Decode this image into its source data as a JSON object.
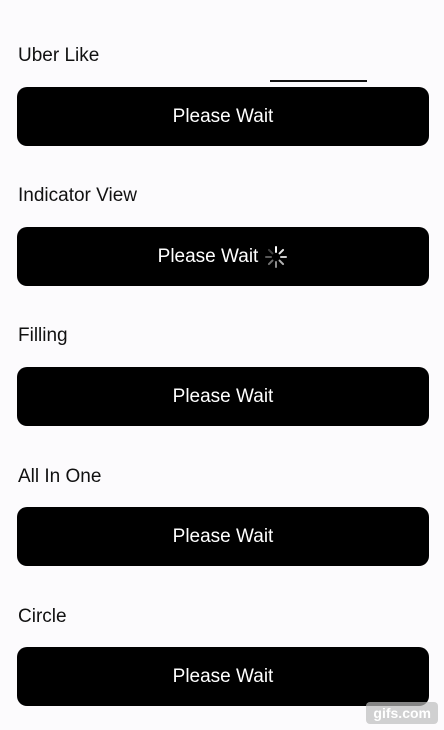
{
  "sections": [
    {
      "title": "Uber Like",
      "button_label": "Please Wait"
    },
    {
      "title": "Indicator View",
      "button_label": "Please Wait"
    },
    {
      "title": "Filling",
      "button_label": "Please Wait"
    },
    {
      "title": "All In One",
      "button_label": "Please Wait"
    },
    {
      "title": "Circle",
      "button_label": "Please Wait"
    }
  ],
  "uber_progress": {
    "fraction": 0.24
  },
  "watermark": "gifs.com",
  "colors": {
    "background": "#fcfbfd",
    "button": "#000000",
    "button_text": "#ffffff",
    "title_text": "#111111"
  },
  "icons": {
    "indicator": "activity-indicator-icon"
  }
}
